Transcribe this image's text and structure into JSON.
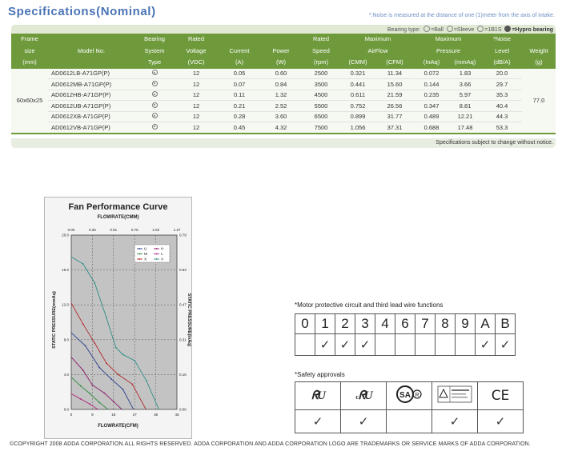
{
  "header": {
    "title": "Specifications(Nominal)",
    "noise_note": "*:Noise is measured at the distance of one (1)meter from the axis of intake.",
    "bearing_type_label": "Bearing type:",
    "bearing_ball": "=Ball",
    "bearing_sleeve": "=Sleeve",
    "bearing_1b1s": "=1B1S",
    "bearing_hypro": "=Hypro bearing"
  },
  "table": {
    "headers": {
      "frame": [
        "Frame",
        "size",
        "(mm)"
      ],
      "model": [
        "",
        "Model No.",
        ""
      ],
      "bearing": [
        "Bearing",
        "System",
        "Type"
      ],
      "voltage": [
        "Rated",
        "Voltage",
        "(VDC)"
      ],
      "current": [
        "",
        "Current",
        "(A)"
      ],
      "power": [
        "",
        "Power",
        "(W)"
      ],
      "speed": [
        "Rated",
        "Speed",
        "(rpm)"
      ],
      "airflow_title": [
        "Maximum",
        "AirFlow"
      ],
      "airflow_cmm": "(CMM)",
      "airflow_cfm": "(CFM)",
      "pressure_title": [
        "Maximum",
        "Pressure"
      ],
      "pressure_inaq": "(InAq)",
      "pressure_mmaq": "(mmAq)",
      "noise": [
        "*Noise",
        "Level",
        "(dB/A)"
      ],
      "weight": [
        "",
        "Weight",
        "(g)"
      ]
    },
    "frame_size": "60x60x25",
    "weight": "77.0",
    "rows": [
      {
        "model": "AD0612LB-A71GP(P)",
        "voltage": "12",
        "current": "0.05",
        "power": "0.60",
        "speed": "2500",
        "cmm": "0.321",
        "cfm": "11.34",
        "inaq": "0.072",
        "mmaq": "1.83",
        "noise": "20.0"
      },
      {
        "model": "AD0612MB-A71GP(P)",
        "voltage": "12",
        "current": "0.07",
        "power": "0.84",
        "speed": "3500",
        "cmm": "0.441",
        "cfm": "15.60",
        "inaq": "0.144",
        "mmaq": "3.66",
        "noise": "29.7"
      },
      {
        "model": "AD0612HB-A71GP(P)",
        "voltage": "12",
        "current": "0.11",
        "power": "1.32",
        "speed": "4500",
        "cmm": "0.611",
        "cfm": "21.59",
        "inaq": "0.235",
        "mmaq": "5.97",
        "noise": "35.3"
      },
      {
        "model": "AD0612UB-A71GP(P)",
        "voltage": "12",
        "current": "0.21",
        "power": "2.52",
        "speed": "5500",
        "cmm": "0.752",
        "cfm": "26.56",
        "inaq": "0.347",
        "mmaq": "8.81",
        "noise": "40.4"
      },
      {
        "model": "AD0612XB-A71GP(P)",
        "voltage": "12",
        "current": "0.28",
        "power": "3.60",
        "speed": "6500",
        "cmm": "0.899",
        "cfm": "31.77",
        "inaq": "0.489",
        "mmaq": "12.21",
        "noise": "44.3"
      },
      {
        "model": "AD0612VB-A71GP(P)",
        "voltage": "12",
        "current": "0.45",
        "power": "4.32",
        "speed": "7500",
        "cmm": "1.056",
        "cfm": "37.31",
        "inaq": "0.688",
        "mmaq": "17.48",
        "noise": "53.3"
      }
    ],
    "subject_note": "Specifications subject to change without notice."
  },
  "chart_data": {
    "type": "line",
    "title": "Fan Performance Curve",
    "xlabel_top": "FLOWRATE(CMM)",
    "xlabel": "FLOWRATE(CFM)",
    "ylabel": "STATIC PRESSURE(mmAq)",
    "ylabel_right": "STATIC PRESSURE(InAq)",
    "x_ticks": [
      "0",
      "9",
      "18",
      "27",
      "36",
      "45"
    ],
    "x_top_ticks": [
      "0.00",
      "0.25",
      "0.51",
      "0.76",
      "1.02",
      "1.27"
    ],
    "y_ticks": [
      "0.0",
      "4.0",
      "8.0",
      "12.0",
      "16.0",
      "20.0"
    ],
    "y_right_ticks": [
      "0.00",
      "0.16",
      "0.31",
      "0.47",
      "0.63",
      "0.79"
    ],
    "xlim": [
      0,
      45
    ],
    "ylim": [
      0,
      20
    ],
    "grid": true,
    "legend_position": "top-right",
    "series": [
      {
        "name": "U",
        "color": "#2b3f8c",
        "x": [
          0,
          6,
          12,
          17,
          22,
          26.5
        ],
        "y": [
          8.8,
          7.3,
          4.8,
          3.5,
          2.3,
          0
        ]
      },
      {
        "name": "H",
        "color": "#8b1a6b",
        "x": [
          0,
          5,
          9,
          14,
          18,
          21.6
        ],
        "y": [
          6.0,
          4.5,
          2.8,
          1.9,
          0.9,
          0
        ]
      },
      {
        "name": "M",
        "color": "#2c8a3c",
        "x": [
          0,
          4,
          8,
          12,
          15.6
        ],
        "y": [
          3.7,
          2.7,
          1.8,
          0.8,
          0
        ]
      },
      {
        "name": "L",
        "color": "#b0267e",
        "x": [
          0,
          4,
          8,
          11.3
        ],
        "y": [
          1.8,
          1.2,
          0.6,
          0
        ]
      },
      {
        "name": "X",
        "color": "#b22a2a",
        "x": [
          0,
          5,
          10,
          15,
          20,
          26,
          31.8
        ],
        "y": [
          12.2,
          9.8,
          7.6,
          5.3,
          4.0,
          2.9,
          0
        ]
      },
      {
        "name": "V",
        "color": "#2f8f87",
        "x": [
          0,
          5,
          10,
          15,
          19,
          22,
          27,
          32,
          37.3
        ],
        "y": [
          17.5,
          16.7,
          14.5,
          10.5,
          7.1,
          6.3,
          5.6,
          3.3,
          0
        ]
      }
    ]
  },
  "motor": {
    "label": "*Motor protective circuit and third lead wire functions",
    "columns": [
      "0",
      "1",
      "2",
      "3",
      "4",
      "6",
      "7",
      "8",
      "9",
      "A",
      "B"
    ],
    "checks": [
      false,
      true,
      true,
      true,
      false,
      false,
      false,
      false,
      false,
      true,
      true
    ],
    "check_glyph": "✓"
  },
  "safety": {
    "label": "*Safety approvals",
    "marks": [
      {
        "icon": "ul-recognized-icon",
        "text": "ᖇU"
      },
      {
        "icon": "cul-recognized-icon",
        "prefix": "c",
        "text": "ᖇU"
      },
      {
        "icon": "csa-icon",
        "text": "SA"
      },
      {
        "icon": "tuv-icon",
        "text": ""
      },
      {
        "icon": "ce-mark-icon",
        "text": "CE"
      }
    ],
    "checks": [
      true,
      true,
      false,
      true,
      true
    ],
    "check_glyph": "✓"
  },
  "footer": {
    "copyright": "©COPYRIGHT 2008 ADDA CORPORATION.ALL RIGHTS RESERVED. ADDA CORPORATION AND ADDA  CORPORATION LOGO ARE TRADEMARKS OR SERVICE MARKS OF ADDA CORPORATION."
  },
  "colors": {
    "title_blue": "#4a74b5",
    "header_green": "#6e9a3c",
    "plot_bg": "#c3c3c3"
  }
}
